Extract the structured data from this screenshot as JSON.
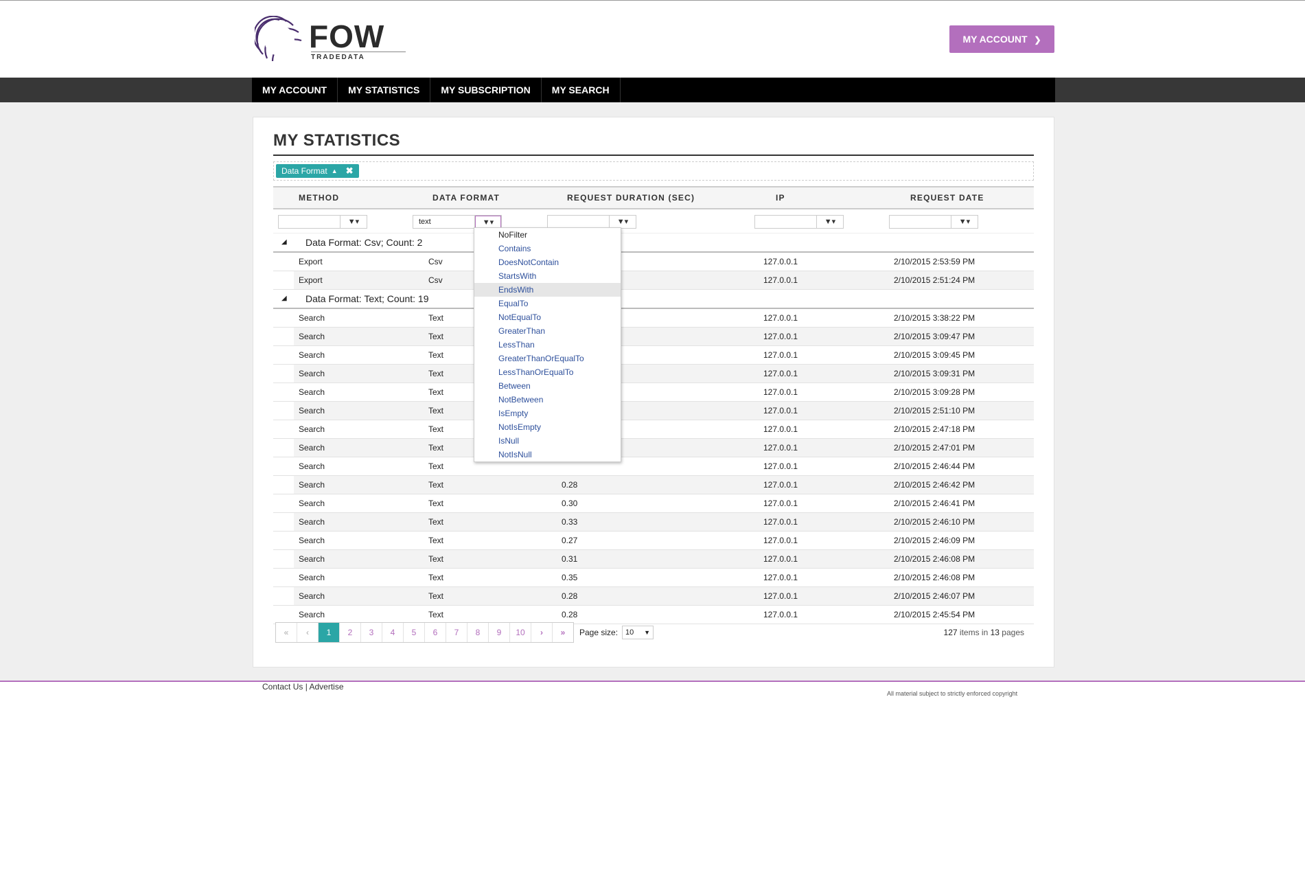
{
  "header": {
    "logo_text": "FOW",
    "logo_sub": "TRADEDATA",
    "account_button": "MY ACCOUNT"
  },
  "nav": [
    "MY ACCOUNT",
    "MY STATISTICS",
    "MY SUBSCRIPTION",
    "MY SEARCH"
  ],
  "page_title": "MY STATISTICS",
  "group_chip": "Data Format",
  "columns": [
    "METHOD",
    "DATA FORMAT",
    "REQUEST DURATION (SEC)",
    "IP",
    "REQUEST DATE"
  ],
  "filters": {
    "data_format_value": "text"
  },
  "groups": [
    {
      "title": "Data Format: Csv; Count: 2",
      "rows": [
        {
          "method": "Export",
          "format": "Csv",
          "duration": "",
          "ip": "127.0.0.1",
          "date": "2/10/2015 2:53:59 PM"
        },
        {
          "method": "Export",
          "format": "Csv",
          "duration": "",
          "ip": "127.0.0.1",
          "date": "2/10/2015 2:51:24 PM"
        }
      ]
    },
    {
      "title": "Data Format: Text; Count: 19",
      "rows": [
        {
          "method": "Search",
          "format": "Text",
          "duration": "",
          "ip": "127.0.0.1",
          "date": "2/10/2015 3:38:22 PM"
        },
        {
          "method": "Search",
          "format": "Text",
          "duration": "",
          "ip": "127.0.0.1",
          "date": "2/10/2015 3:09:47 PM"
        },
        {
          "method": "Search",
          "format": "Text",
          "duration": "",
          "ip": "127.0.0.1",
          "date": "2/10/2015 3:09:45 PM"
        },
        {
          "method": "Search",
          "format": "Text",
          "duration": "",
          "ip": "127.0.0.1",
          "date": "2/10/2015 3:09:31 PM"
        },
        {
          "method": "Search",
          "format": "Text",
          "duration": "",
          "ip": "127.0.0.1",
          "date": "2/10/2015 3:09:28 PM"
        },
        {
          "method": "Search",
          "format": "Text",
          "duration": "",
          "ip": "127.0.0.1",
          "date": "2/10/2015 2:51:10 PM"
        },
        {
          "method": "Search",
          "format": "Text",
          "duration": "",
          "ip": "127.0.0.1",
          "date": "2/10/2015 2:47:18 PM"
        },
        {
          "method": "Search",
          "format": "Text",
          "duration": "",
          "ip": "127.0.0.1",
          "date": "2/10/2015 2:47:01 PM"
        },
        {
          "method": "Search",
          "format": "Text",
          "duration": "",
          "ip": "127.0.0.1",
          "date": "2/10/2015 2:46:44 PM"
        },
        {
          "method": "Search",
          "format": "Text",
          "duration": "0.28",
          "ip": "127.0.0.1",
          "date": "2/10/2015 2:46:42 PM"
        },
        {
          "method": "Search",
          "format": "Text",
          "duration": "0.30",
          "ip": "127.0.0.1",
          "date": "2/10/2015 2:46:41 PM"
        },
        {
          "method": "Search",
          "format": "Text",
          "duration": "0.33",
          "ip": "127.0.0.1",
          "date": "2/10/2015 2:46:10 PM"
        },
        {
          "method": "Search",
          "format": "Text",
          "duration": "0.27",
          "ip": "127.0.0.1",
          "date": "2/10/2015 2:46:09 PM"
        },
        {
          "method": "Search",
          "format": "Text",
          "duration": "0.31",
          "ip": "127.0.0.1",
          "date": "2/10/2015 2:46:08 PM"
        },
        {
          "method": "Search",
          "format": "Text",
          "duration": "0.35",
          "ip": "127.0.0.1",
          "date": "2/10/2015 2:46:08 PM"
        },
        {
          "method": "Search",
          "format": "Text",
          "duration": "0.28",
          "ip": "127.0.0.1",
          "date": "2/10/2015 2:46:07 PM"
        },
        {
          "method": "Search",
          "format": "Text",
          "duration": "0.28",
          "ip": "127.0.0.1",
          "date": "2/10/2015 2:45:54 PM"
        }
      ]
    }
  ],
  "filter_menu": [
    "NoFilter",
    "Contains",
    "DoesNotContain",
    "StartsWith",
    "EndsWith",
    "EqualTo",
    "NotEqualTo",
    "GreaterThan",
    "LessThan",
    "GreaterThanOrEqualTo",
    "LessThanOrEqualTo",
    "Between",
    "NotBetween",
    "IsEmpty",
    "NotIsEmpty",
    "IsNull",
    "NotIsNull"
  ],
  "filter_menu_hover": "EndsWith",
  "pager": {
    "pages": [
      "1",
      "2",
      "3",
      "4",
      "5",
      "6",
      "7",
      "8",
      "9",
      "10"
    ],
    "current": "1",
    "page_size_label": "Page size:",
    "page_size": "10",
    "items_total": "127",
    "items_label": "items in",
    "pages_total": "13",
    "pages_label": "pages"
  },
  "footer": {
    "contact": "Contact Us",
    "separator": "|",
    "advertise": "Advertise",
    "copyright": "All material subject to strictly enforced copyright"
  },
  "colors": {
    "accent_purple": "#b36fbd",
    "accent_teal": "#2ba6a6",
    "nav_black": "#000000"
  },
  "icons": [
    "filter-icon",
    "chevron-down-icon",
    "close-icon",
    "caret-up-icon",
    "first-page-icon",
    "prev-page-icon",
    "next-page-icon",
    "last-page-icon"
  ]
}
